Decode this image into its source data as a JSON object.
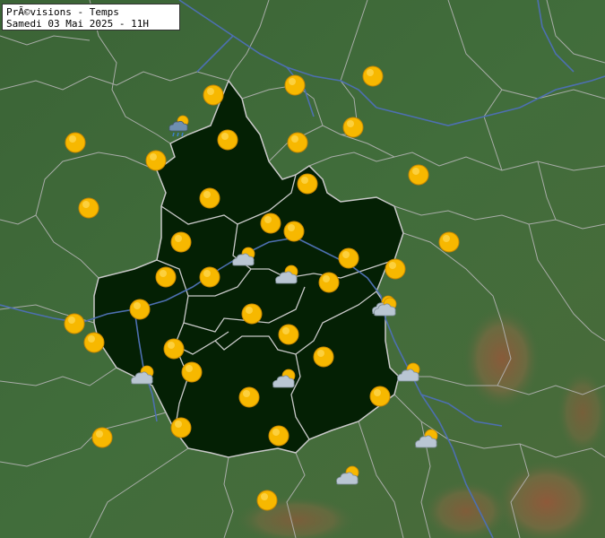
{
  "header": {
    "title": "PrÃ©visions - Temps",
    "date_line": "Samedi 03 Mai 2025 - 11H"
  },
  "colors": {
    "region_fill": "#042004",
    "terrain": "#3f6a3a",
    "borders": "#c8c8c8",
    "rivers": "#4d6fb0",
    "sun": "#f7b800",
    "cloud": "#b9c6d3"
  },
  "weather_icons": [
    {
      "type": "sun-icon"
    },
    {
      "type": "sun-icon"
    },
    {
      "type": "sun-icon"
    },
    {
      "type": "sun-icon"
    },
    {
      "type": "sun-icon"
    },
    {
      "type": "sun-icon"
    },
    {
      "type": "sun-icon"
    },
    {
      "type": "sun-icon"
    },
    {
      "type": "sun-icon"
    },
    {
      "type": "sun-icon"
    },
    {
      "type": "sun-icon"
    },
    {
      "type": "sun-icon"
    },
    {
      "type": "sun-icon"
    },
    {
      "type": "sun-icon"
    },
    {
      "type": "sun-icon"
    },
    {
      "type": "sun-icon"
    },
    {
      "type": "sun-icon"
    },
    {
      "type": "sun-icon"
    },
    {
      "type": "sun-icon"
    },
    {
      "type": "sun-icon"
    },
    {
      "type": "sun-icon"
    },
    {
      "type": "sun-icon"
    },
    {
      "type": "sun-icon"
    },
    {
      "type": "sun-icon"
    },
    {
      "type": "sun-icon"
    },
    {
      "type": "sun-icon"
    },
    {
      "type": "sun-icon"
    },
    {
      "type": "sun-icon"
    },
    {
      "type": "sun-icon"
    },
    {
      "type": "sun-icon"
    },
    {
      "type": "sun-icon"
    },
    {
      "type": "sun-icon"
    },
    {
      "type": "sun-icon"
    },
    {
      "type": "sun-icon"
    },
    {
      "type": "sun-icon"
    },
    {
      "type": "sun-cloud-icon"
    },
    {
      "type": "sun-cloud-icon"
    },
    {
      "type": "sun-cloud-icon"
    },
    {
      "type": "sun-cloud-icon"
    },
    {
      "type": "sun-cloud-icon"
    },
    {
      "type": "sun-cloud-icon"
    },
    {
      "type": "sun-cloud-icon"
    },
    {
      "type": "sun-cloud-icon"
    },
    {
      "type": "sun-cloud-icon"
    },
    {
      "type": "sun-cloud-rain-icon"
    }
  ]
}
